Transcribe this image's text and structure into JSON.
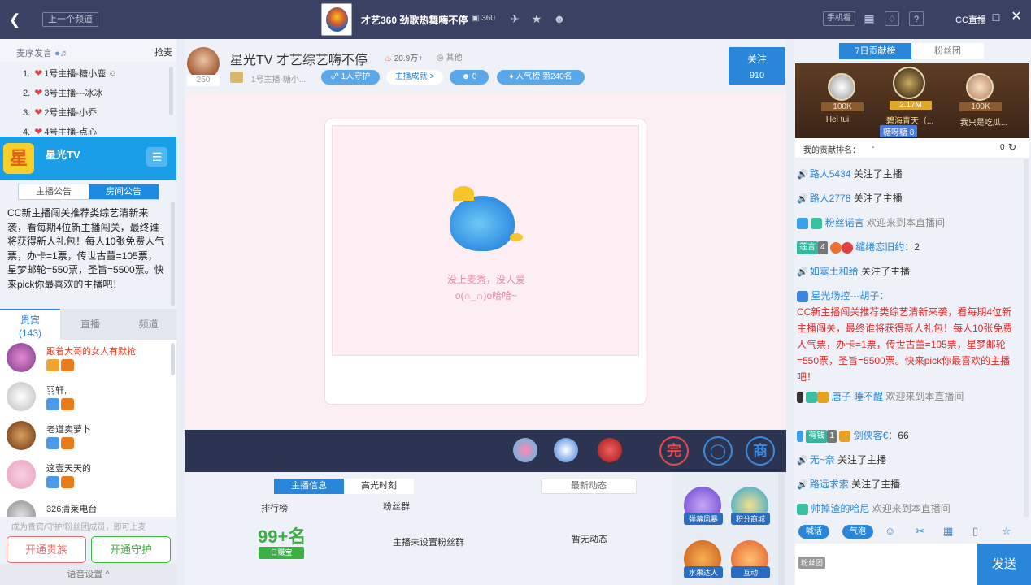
{
  "topbar": {
    "prev_label": "上一个频道",
    "channel_title": "才艺360 劲歌热舞嗨不停",
    "room_id": "360",
    "btn_phone": "手机看",
    "help": "?",
    "cc_logo": "CC直播"
  },
  "left": {
    "fans_title": "麦序发言",
    "grab": "抢麦",
    "ranks": [
      {
        "n": "1.",
        "label": "1号主播-糖小鹿"
      },
      {
        "n": "2.",
        "label": "3号主播---冰冰"
      },
      {
        "n": "3.",
        "label": "2号主播-小乔"
      },
      {
        "n": "4.",
        "label": "4号主播-点心"
      }
    ],
    "banner_icon": "星",
    "banner_name": "星光TV",
    "ann_tabs": [
      "主播公告",
      "房间公告"
    ],
    "announcement": "CC新主播闯关推荐类综艺清新来袭，看每期4位新主播闯关，最终谁将获得新人礼包！每人10张免费人气票，办卡=1票，传世古董=105票，星梦邮轮=550票，圣旨=5500票。快来pick你最喜欢的主播吧！",
    "tabs": {
      "noble": "贵宾",
      "noble_count": "(143)",
      "live": "直播",
      "channel": "频道"
    },
    "users": [
      {
        "name": "跟着大哥的女人有默抢",
        "color": "#e0402a"
      },
      {
        "name": "羽轩,",
        "color": "#333"
      },
      {
        "name": "老道卖萝卜",
        "color": "#333"
      },
      {
        "name": "这壹天天的",
        "color": "#333"
      },
      {
        "name": "326清莱电台",
        "color": "#333"
      }
    ],
    "hint": "成为贵宾/守护/粉丝团成员，即可上麦",
    "open_noble": "开通贵族",
    "open_guard": "开通守护",
    "voice_settings": "语音设置 ^"
  },
  "center": {
    "anchor_level": "250",
    "anchor_name": "星光TV 才艺综艺嗨不停",
    "hot": "20.9万+",
    "other": "其他",
    "anchor_sub": "1号主播-糖小...",
    "guard_pill": "1人守护",
    "achv_pill": "主播成就 >",
    "fans_count": "0",
    "pop_pill": "人气榜 第240名",
    "follow": "关注",
    "follow_count": "910",
    "empty_msg1": "没上麦秀，没人爱",
    "empty_msg2": "o(∩_∩)o哈哈~",
    "info_tabs": [
      "主播信息",
      "高光时刻"
    ],
    "dyn_title": "最新动态",
    "rank_lbl": "排行榜",
    "fans_group_lbl": "粉丝群",
    "big99": "99+名",
    "rdb": "日赚宝",
    "no_group": "主播未设置粉丝群",
    "no_dyn": "暂无动态",
    "acts": [
      "弹幕风暴",
      "积分商城",
      "水果达人",
      "互动"
    ]
  },
  "right": {
    "tab7": "7日贡献榜",
    "tab_fans": "粉丝团",
    "podium": [
      {
        "name": "Hei    tui",
        "val": "100K"
      },
      {
        "name": "碧海青天（...",
        "val": "2.17M"
      },
      {
        "name": "我只是吃瓜...",
        "val": "100K"
      }
    ],
    "sugar": "糖呀糖",
    "sugar_lv": "8",
    "my_rank_label": "我的贡献排名：",
    "my_rank_val": "-",
    "my_rank_num": "0",
    "chat": [
      {
        "nick": "路人5434",
        "msg": "关注了主播"
      },
      {
        "nick": "路人2778",
        "msg": "关注了主播"
      },
      {
        "nick": "粉丝诺言",
        "msg": "欢迎来到本直播间"
      },
      {
        "tag": "莲言",
        "lv": "4",
        "nick": "缱绻恋旧约：",
        "msg": "2"
      },
      {
        "nick": "如霙土和给",
        "msg": "关注了主播"
      },
      {
        "nick": "星光场控---胡子：",
        "msg": "CC新主播闯关推荐类综艺清新来袭，看每期4位新主播闯关，最终谁将获得新人礼包！每人10张免费人气票，办卡=1票，传世古董=105票，星梦邮轮=550票，圣旨=5500票。快来pick你最喜欢的主播吧！"
      },
      {
        "nick": "唐子",
        "nick2": "睡不醒",
        "msg": "欢迎来到本直播间"
      },
      {
        "tag": "有钱",
        "lv": "1",
        "nick": "剑侠客€：",
        "msg": "66"
      },
      {
        "nick": "无~奈",
        "msg": "关注了主播"
      },
      {
        "nick": "路远求索",
        "msg": "关注了主播"
      },
      {
        "nick": "帅掉渣的哈尼",
        "msg": "欢迎来到本直播间"
      }
    ],
    "btn_talk": "喊话",
    "btn_bubble": "气泡",
    "fans_badge": "粉丝团",
    "send": "发送"
  }
}
